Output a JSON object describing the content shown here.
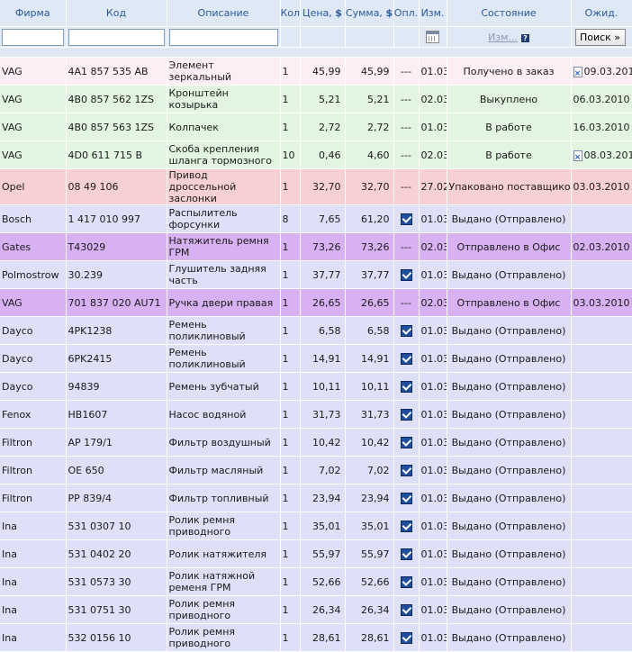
{
  "header": {
    "firm": "Фирма",
    "code": "Код",
    "desc": "Описание",
    "qty": "Кол",
    "price": "Цена,",
    "sum": "Сумма,",
    "currency": "$",
    "paid": "Опл.",
    "changed": "Изм.",
    "state": "Состояние",
    "wait": "Ожид."
  },
  "filters": {
    "state_link": "Изм...",
    "help": "?",
    "search_button": "Поиск »"
  },
  "colors": {
    "pink": "#fdeef3",
    "green": "#e2f5e0",
    "red": "#f7d0d4",
    "blue": "#dde0f6",
    "violet": "#d7b1f1"
  },
  "rows": [
    {
      "firm": "VAG",
      "code": "4A1 857 535 AB",
      "desc": "Элемент зеркальный",
      "qty": "1",
      "price": "45,99",
      "sum": "45,99",
      "paid": "---",
      "changed": "01.03",
      "state": "Получено в заказ",
      "wait": "09.03.2010",
      "color": "pink",
      "doc": true
    },
    {
      "firm": "VAG",
      "code": "4B0 857 562 1ZS",
      "desc": "Кронштейн козырька",
      "qty": "1",
      "price": "5,21",
      "sum": "5,21",
      "paid": "---",
      "changed": "02.03",
      "state": "Выкуплено",
      "wait": "06.03.2010",
      "color": "green",
      "doc": false
    },
    {
      "firm": "VAG",
      "code": "4B0 857 563 1ZS",
      "desc": "Колпачек",
      "qty": "1",
      "price": "2,72",
      "sum": "2,72",
      "paid": "---",
      "changed": "01.03",
      "state": "В работе",
      "wait": "16.03.2010",
      "color": "green",
      "doc": false
    },
    {
      "firm": "VAG",
      "code": "4D0 611 715 B",
      "desc": "Скоба крепления шланга тормозного",
      "qty": "10",
      "price": "0,46",
      "sum": "4,60",
      "paid": "---",
      "changed": "02.03",
      "state": "В работе",
      "wait": "08.03.2010",
      "color": "green",
      "doc": true
    },
    {
      "firm": "Opel",
      "code": "08 49 106",
      "desc": "Привод дроссельной заслонки",
      "qty": "1",
      "price": "32,70",
      "sum": "32,70",
      "paid": "---",
      "changed": "27.02",
      "state": "Упаковано поставщиком",
      "wait": "03.03.2010",
      "color": "red",
      "doc": false
    },
    {
      "firm": "Bosch",
      "code": "1 417 010 997",
      "desc": "Распылитель форсунки",
      "qty": "8",
      "price": "7,65",
      "sum": "61,20",
      "paid": "check",
      "changed": "01.03",
      "state": "Выдано (Отправлено)",
      "wait": "",
      "color": "blue",
      "doc": false
    },
    {
      "firm": "Gates",
      "code": "T43029",
      "desc": "Натяжитель ремня ГРМ",
      "qty": "1",
      "price": "73,26",
      "sum": "73,26",
      "paid": "---",
      "changed": "02.03",
      "state": "Отправлено в Офис",
      "wait": "02.03.2010",
      "color": "violet",
      "doc": false
    },
    {
      "firm": "Polmostrow",
      "code": "30.239",
      "desc": "Глушитель задняя часть",
      "qty": "1",
      "price": "37,77",
      "sum": "37,77",
      "paid": "check",
      "changed": "01.03",
      "state": "Выдано (Отправлено)",
      "wait": "",
      "color": "blue",
      "doc": false
    },
    {
      "firm": "VAG",
      "code": "701 837 020 AU71",
      "desc": "Ручка двери правая",
      "qty": "1",
      "price": "26,65",
      "sum": "26,65",
      "paid": "---",
      "changed": "02.03",
      "state": "Отправлено в Офис",
      "wait": "03.03.2010",
      "color": "violet",
      "doc": false
    },
    {
      "firm": "Dayco",
      "code": "4PK1238",
      "desc": "Ремень поликлиновый",
      "qty": "1",
      "price": "6,58",
      "sum": "6,58",
      "paid": "check",
      "changed": "01.03",
      "state": "Выдано (Отправлено)",
      "wait": "",
      "color": "blue",
      "doc": false
    },
    {
      "firm": "Dayco",
      "code": "6PK2415",
      "desc": "Ремень поликлиновый",
      "qty": "1",
      "price": "14,91",
      "sum": "14,91",
      "paid": "check",
      "changed": "01.03",
      "state": "Выдано (Отправлено)",
      "wait": "",
      "color": "blue",
      "doc": false
    },
    {
      "firm": "Dayco",
      "code": "94839",
      "desc": "Ремень зубчатый",
      "qty": "1",
      "price": "10,11",
      "sum": "10,11",
      "paid": "check",
      "changed": "01.03",
      "state": "Выдано (Отправлено)",
      "wait": "",
      "color": "blue",
      "doc": false
    },
    {
      "firm": "Fenox",
      "code": "HB1607",
      "desc": "Насос водяной",
      "qty": "1",
      "price": "31,73",
      "sum": "31,73",
      "paid": "check",
      "changed": "01.03",
      "state": "Выдано (Отправлено)",
      "wait": "",
      "color": "blue",
      "doc": false
    },
    {
      "firm": "Filtron",
      "code": "AP 179/1",
      "desc": "Фильтр воздушный",
      "qty": "1",
      "price": "10,42",
      "sum": "10,42",
      "paid": "check",
      "changed": "01.03",
      "state": "Выдано (Отправлено)",
      "wait": "",
      "color": "blue",
      "doc": false
    },
    {
      "firm": "Filtron",
      "code": "OE 650",
      "desc": "Фильтр масляный",
      "qty": "1",
      "price": "7,02",
      "sum": "7,02",
      "paid": "check",
      "changed": "01.03",
      "state": "Выдано (Отправлено)",
      "wait": "",
      "color": "blue",
      "doc": false
    },
    {
      "firm": "Filtron",
      "code": "PP 839/4",
      "desc": "Фильтр топливный",
      "qty": "1",
      "price": "23,94",
      "sum": "23,94",
      "paid": "check",
      "changed": "01.03",
      "state": "Выдано (Отправлено)",
      "wait": "",
      "color": "blue",
      "doc": false
    },
    {
      "firm": "Ina",
      "code": "531 0307 10",
      "desc": "Ролик ремня приводного",
      "qty": "1",
      "price": "35,01",
      "sum": "35,01",
      "paid": "check",
      "changed": "01.03",
      "state": "Выдано (Отправлено)",
      "wait": "",
      "color": "blue",
      "doc": false
    },
    {
      "firm": "Ina",
      "code": "531 0402 20",
      "desc": "Ролик натяжителя",
      "qty": "1",
      "price": "55,97",
      "sum": "55,97",
      "paid": "check",
      "changed": "01.03",
      "state": "Выдано (Отправлено)",
      "wait": "",
      "color": "blue",
      "doc": false
    },
    {
      "firm": "Ina",
      "code": "531 0573 30",
      "desc": "Ролик натяжной ременя ГРМ",
      "qty": "1",
      "price": "52,66",
      "sum": "52,66",
      "paid": "check",
      "changed": "01.03",
      "state": "Выдано (Отправлено)",
      "wait": "",
      "color": "blue",
      "doc": false
    },
    {
      "firm": "Ina",
      "code": "531 0751 30",
      "desc": "Ролик ремня приводного",
      "qty": "1",
      "price": "26,34",
      "sum": "26,34",
      "paid": "check",
      "changed": "01.03",
      "state": "Выдано (Отправлено)",
      "wait": "",
      "color": "blue",
      "doc": false
    },
    {
      "firm": "Ina",
      "code": "532 0156 10",
      "desc": "Ролик ремня приводного",
      "qty": "1",
      "price": "28,61",
      "sum": "28,61",
      "paid": "check",
      "changed": "01.03",
      "state": "Выдано (Отправлено)",
      "wait": "",
      "color": "blue",
      "doc": false
    }
  ]
}
